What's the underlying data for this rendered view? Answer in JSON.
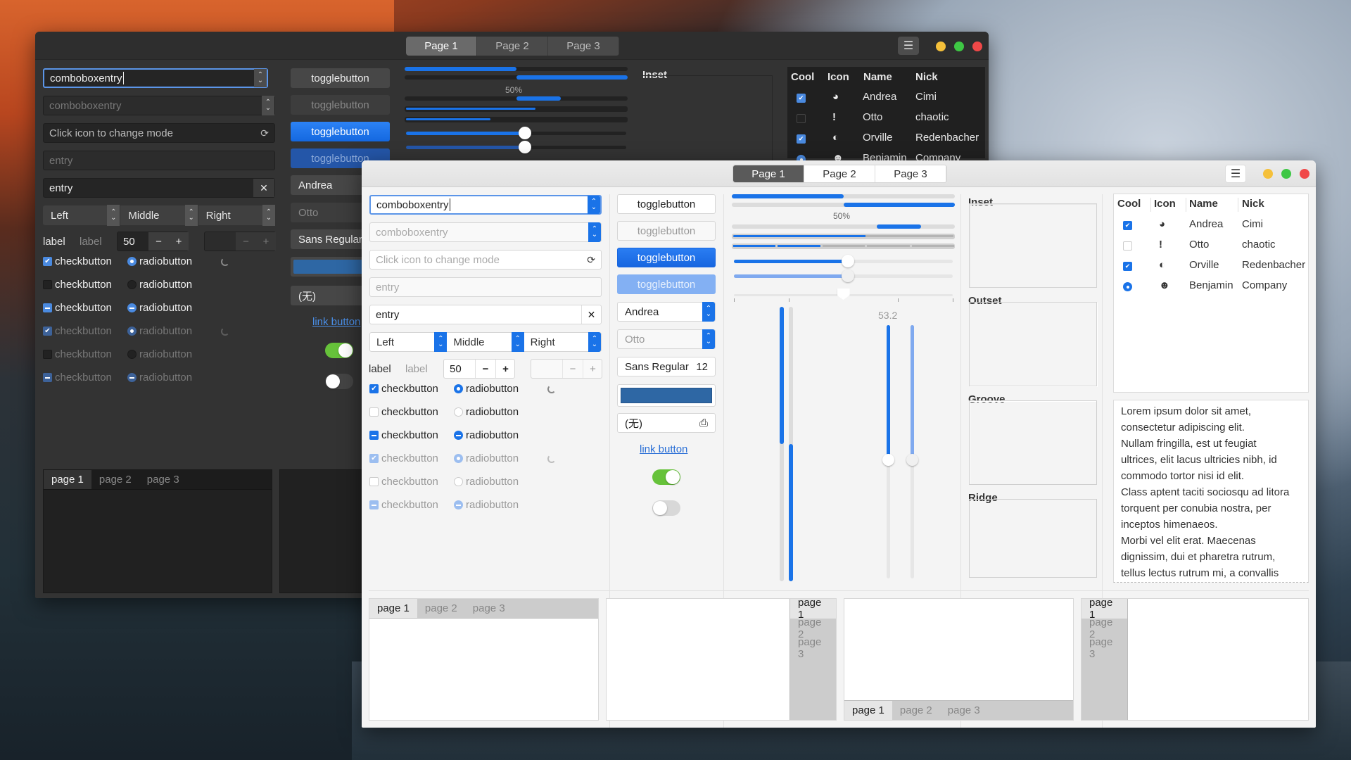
{
  "colors": {
    "accent": "#1a73e8",
    "switch_on": "#66c23a",
    "close": "#f04848",
    "minimize": "#f5c03a",
    "maximize": "#3ec744",
    "color_button": "#2e67a4"
  },
  "dark": {
    "stack_tabs": [
      "Page 1",
      "Page 2",
      "Page 3"
    ],
    "menu_icon": "☰",
    "combo1": "comboboxentry",
    "combo2": "comboboxentry",
    "entry_mode_placeholder": "Click icon to change mode",
    "entry_placeholder": "entry",
    "entry_value": "entry",
    "clear_icon": "✕",
    "refresh_icon": "⟳",
    "linked": [
      "Left",
      "Middle",
      "Right"
    ],
    "label1": "label",
    "label2": "label",
    "spin_value": "50",
    "minus": "−",
    "plus": "+",
    "check_label": "checkbutton",
    "radio_label": "radiobutton",
    "toggles": [
      "togglebutton",
      "togglebutton",
      "togglebutton",
      "togglebutton"
    ],
    "combo_andrea": "Andrea",
    "combo_otto": "Otto",
    "font_button": "Sans Regular",
    "file_button": "(无)",
    "link_button": "link button",
    "progress_label": "50%",
    "inset": "Inset",
    "tree": {
      "headers": [
        "Cool",
        "Icon",
        "Name",
        "Nick"
      ],
      "rows": [
        {
          "cool": "check",
          "icon": "◕",
          "name": "Andrea",
          "nick": "Cimi"
        },
        {
          "cool": "uncheck",
          "icon": "!",
          "name": "Otto",
          "nick": "chaotic"
        },
        {
          "cool": "check",
          "icon": "◐",
          "name": "Orville",
          "nick": "Redenbacher"
        },
        {
          "cool": "radio",
          "icon": "☻",
          "name": "Benjamin",
          "nick": "Company"
        }
      ]
    },
    "notebook_tabs": [
      "page 1",
      "page 2",
      "page 3"
    ]
  },
  "light": {
    "stack_tabs": [
      "Page 1",
      "Page 2",
      "Page 3"
    ],
    "menu_icon": "☰",
    "combo1": "comboboxentry",
    "combo2": "comboboxentry",
    "entry_mode_placeholder": "Click icon to change mode",
    "entry_placeholder": "entry",
    "entry_value": "entry",
    "clear_icon": "✕",
    "refresh_icon": "⟳",
    "linked": [
      "Left",
      "Middle",
      "Right"
    ],
    "label1": "label",
    "label2": "label",
    "spin_value": "50",
    "minus": "−",
    "plus": "+",
    "check_label": "checkbutton",
    "radio_label": "radiobutton",
    "toggles": [
      "togglebutton",
      "togglebutton",
      "togglebutton",
      "togglebutton"
    ],
    "combo_andrea": "Andrea",
    "combo_otto": "Otto",
    "font_button": "Sans Regular",
    "font_size": "12",
    "file_button": "(无)",
    "file_icon": "⎙",
    "link_button": "link button",
    "progress_label": "50%",
    "scale_value": "53.2",
    "progress": {
      "left_half": 0.5,
      "right_half": 0.5,
      "pulse_start": 0.65,
      "pulse_end": 0.85,
      "bar3": 0.6,
      "bar4_segments": 2,
      "bar4_total": 5
    },
    "sliders": {
      "h1": 0.52,
      "h2": 0.52,
      "marks": 0.5,
      "v_progress_top": 0.5,
      "v_scale": 0.53
    },
    "switches": {
      "on": true,
      "off": false
    },
    "frames": [
      "Inset",
      "Outset",
      "Groove",
      "Ridge"
    ],
    "tree": {
      "headers": [
        "Cool",
        "Icon",
        "Name",
        "Nick"
      ],
      "rows": [
        {
          "cool": "check",
          "icon": "◕",
          "name": "Andrea",
          "nick": "Cimi"
        },
        {
          "cool": "uncheck",
          "icon": "!",
          "name": "Otto",
          "nick": "chaotic"
        },
        {
          "cool": "check",
          "icon": "◐",
          "name": "Orville",
          "nick": "Redenbacher"
        },
        {
          "cool": "radio",
          "icon": "☻",
          "name": "Benjamin",
          "nick": "Company"
        }
      ]
    },
    "textview": [
      "Lorem ipsum dolor sit amet,",
      "consectetur adipiscing elit.",
      "Nullam fringilla, est ut feugiat",
      "ultrices, elit lacus ultricies nibh, id",
      "commodo tortor nisi id elit.",
      "Class aptent taciti sociosqu ad litora",
      "torquent per conubia nostra, per",
      "inceptos himenaeos.",
      "Morbi vel elit erat. Maecenas",
      "dignissim, dui et pharetra rutrum,",
      "tellus lectus rutrum mi, a convallis"
    ],
    "notebook_tabs": [
      "page 1",
      "page 2",
      "page 3"
    ]
  }
}
